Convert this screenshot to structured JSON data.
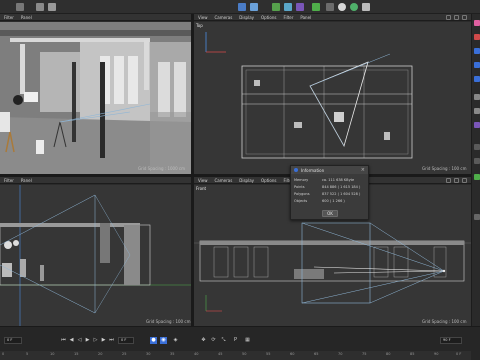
{
  "viewports": {
    "perspective": {
      "menu": [
        "Filter",
        "Panel"
      ],
      "grid_label": "Grid Spacing : 1000 cm"
    },
    "top": {
      "menu": [
        "View",
        "Cameras",
        "Display",
        "Options",
        "Filter",
        "Panel"
      ],
      "name": "Top",
      "grid_label": "Grid Spacing : 100 cm"
    },
    "right": {
      "menu": [
        "Filter",
        "Panel"
      ],
      "grid_label": "Grid Spacing : 100 cm"
    },
    "front": {
      "menu": [
        "View",
        "Cameras",
        "Display",
        "Options",
        "Filter",
        "Panel"
      ],
      "name": "Front",
      "grid_label": "Grid Spacing : 100 cm"
    }
  },
  "info_dialog": {
    "title": "Information",
    "rows": [
      {
        "label": "Memory",
        "value": "ca. 111 638 KByte"
      },
      {
        "label": "Points",
        "value": "844 886 ( 1 615 184 )"
      },
      {
        "label": "Polygons",
        "value": "837 522 ( 1 604 528 )"
      },
      {
        "label": "Objects",
        "value": "600 ( 1 266 )"
      }
    ],
    "ok_label": "OK"
  },
  "timeline": {
    "frame_field": "0 F",
    "start_field": "0 F",
    "end_field": "90 F",
    "ruler_ticks": [
      "0",
      "5",
      "10",
      "15",
      "20",
      "25",
      "30",
      "35",
      "40",
      "45",
      "50",
      "55",
      "60",
      "65",
      "70",
      "75",
      "80",
      "85",
      "90"
    ],
    "end_frame": "0 F"
  },
  "colors": {
    "accent": "#3a6fd8",
    "camera_line": "#8fb6d6",
    "wireframe": "#cfcfcf"
  }
}
